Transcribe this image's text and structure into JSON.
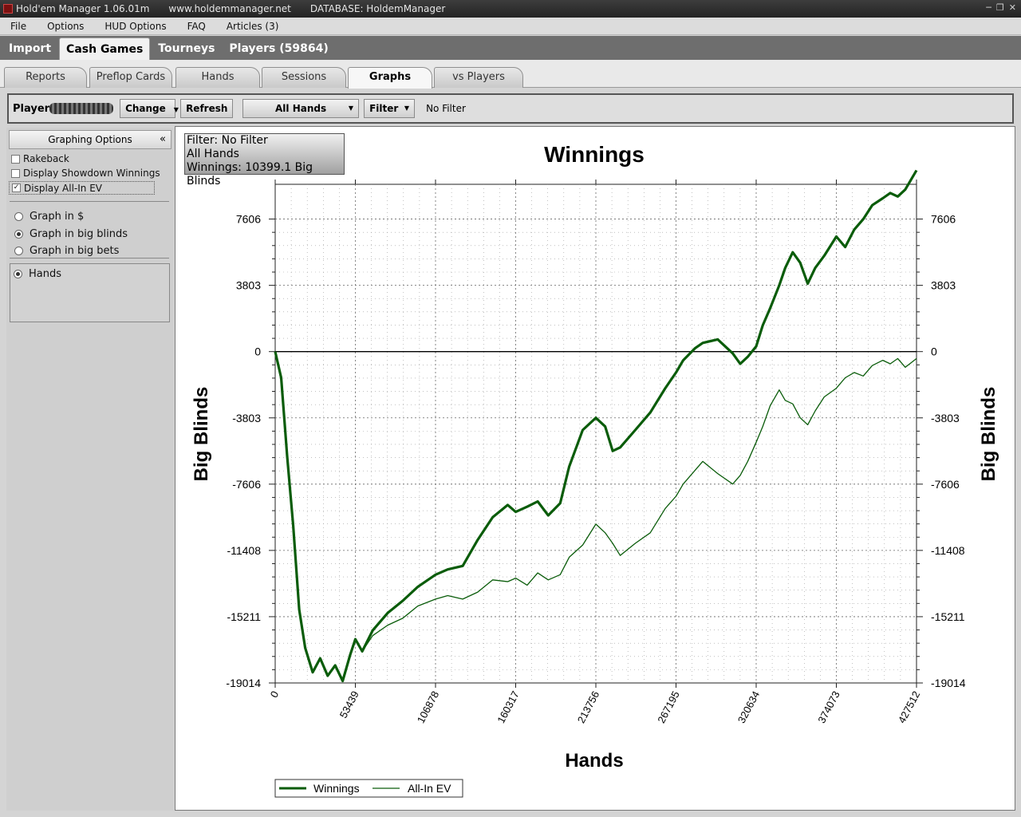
{
  "titlebar": {
    "app": "Hold'em Manager 1.06.01m",
    "site": "www.holdemmanager.net",
    "database": "DATABASE: HoldemManager"
  },
  "menu": [
    "File",
    "Options",
    "HUD Options",
    "FAQ",
    "Articles (3)"
  ],
  "main_tabs": [
    {
      "label": "Import",
      "active": false
    },
    {
      "label": "Cash Games",
      "active": true
    },
    {
      "label": "Tourneys",
      "active": false
    },
    {
      "label": "Players (59864)",
      "active": false
    }
  ],
  "sub_tabs": [
    {
      "label": "Reports",
      "active": false
    },
    {
      "label": "Preflop Cards",
      "active": false
    },
    {
      "label": "Hands",
      "active": false
    },
    {
      "label": "Sessions",
      "active": false
    },
    {
      "label": "Graphs",
      "active": true
    },
    {
      "label": "vs Players",
      "active": false
    }
  ],
  "player_bar": {
    "player_label": "Player",
    "change": "Change",
    "refresh": "Refresh",
    "hands_select": "All Hands",
    "filter": "Filter",
    "filter_status": "No Filter"
  },
  "sidebar": {
    "title": "Graphing Options",
    "collapse_glyph": "«",
    "checkboxes": [
      {
        "label": "Rakeback",
        "checked": false
      },
      {
        "label": "Display Showdown Winnings",
        "checked": false
      },
      {
        "label": "Display All-In EV",
        "checked": true
      }
    ],
    "units": [
      {
        "label": "Graph in $",
        "selected": false
      },
      {
        "label": "Graph in big blinds",
        "selected": true
      },
      {
        "label": "Graph in big bets",
        "selected": false
      }
    ],
    "x_axis_options": [
      {
        "label": "Hands",
        "selected": true
      }
    ]
  },
  "info_box": {
    "filter": "Filter: No Filter",
    "hands": "All Hands",
    "winnings": "Winnings: 10399.1 Big Blinds"
  },
  "colors": {
    "line": "#0a5c0a",
    "zero_line": "#000000",
    "grid": "#9a9a9a"
  },
  "chart_data": {
    "type": "line",
    "title": "Winnings",
    "xlabel": "Hands",
    "ylabel": "Big Blinds",
    "xlim": [
      0,
      427512
    ],
    "ylim": [
      -19014,
      9600
    ],
    "x_ticks": [
      0,
      53439,
      106878,
      160317,
      213756,
      267195,
      320634,
      374073,
      427512
    ],
    "y_ticks": [
      7606,
      3803,
      0,
      -3803,
      -7606,
      -11408,
      -15211,
      -19014
    ],
    "grid": true,
    "legend": "bottom-left",
    "series": [
      {
        "name": "Winnings",
        "x": [
          0,
          4000,
          8000,
          12000,
          16000,
          20000,
          25000,
          30000,
          35000,
          40000,
          45000,
          50000,
          53439,
          58000,
          65000,
          75000,
          85000,
          95000,
          106878,
          115000,
          125000,
          135000,
          145000,
          155000,
          160317,
          168000,
          175000,
          182000,
          190000,
          196000,
          205000,
          213756,
          220000,
          225000,
          230000,
          240000,
          250000,
          260000,
          267195,
          272000,
          280000,
          285000,
          295000,
          305000,
          310000,
          315000,
          320634,
          325000,
          330000,
          336000,
          340000,
          345000,
          350000,
          355000,
          360000,
          366000,
          374073,
          380000,
          386000,
          392000,
          398000,
          405000,
          410000,
          415000,
          420000,
          427512
        ],
        "values": [
          0,
          -1500,
          -6000,
          -10000,
          -14800,
          -17000,
          -18400,
          -17600,
          -18600,
          -18000,
          -18900,
          -17400,
          -16500,
          -17200,
          -16000,
          -15000,
          -14300,
          -13500,
          -12800,
          -12500,
          -12300,
          -10800,
          -9500,
          -8800,
          -9200,
          -8900,
          -8600,
          -9400,
          -8700,
          -6600,
          -4500,
          -3800,
          -4300,
          -5700,
          -5500,
          -4500,
          -3500,
          -2100,
          -1200,
          -500,
          200,
          500,
          700,
          -100,
          -700,
          -300,
          300,
          1500,
          2500,
          3800,
          4800,
          5700,
          5100,
          3900,
          4800,
          5500,
          6600,
          6000,
          7000,
          7600,
          8400,
          8800,
          9100,
          8900,
          9300,
          10399
        ]
      },
      {
        "name": "All-In EV",
        "x": [
          0,
          4000,
          8000,
          12000,
          16000,
          20000,
          25000,
          30000,
          35000,
          40000,
          45000,
          50000,
          53439,
          58000,
          65000,
          75000,
          85000,
          95000,
          106878,
          115000,
          125000,
          135000,
          145000,
          155000,
          160317,
          168000,
          175000,
          182000,
          190000,
          196000,
          205000,
          213756,
          220000,
          225000,
          230000,
          240000,
          250000,
          260000,
          267195,
          272000,
          280000,
          285000,
          295000,
          305000,
          310000,
          315000,
          320634,
          325000,
          330000,
          336000,
          340000,
          345000,
          350000,
          355000,
          360000,
          366000,
          374073,
          380000,
          386000,
          392000,
          398000,
          405000,
          410000,
          415000,
          420000,
          427512
        ],
        "values": [
          0,
          -1500,
          -6000,
          -10000,
          -14800,
          -17000,
          -18400,
          -17600,
          -18600,
          -18000,
          -18900,
          -17400,
          -16500,
          -17200,
          -16300,
          -15700,
          -15300,
          -14600,
          -14200,
          -14000,
          -14200,
          -13800,
          -13100,
          -13200,
          -13000,
          -13400,
          -12700,
          -13100,
          -12800,
          -11800,
          -11100,
          -9900,
          -10400,
          -11000,
          -11700,
          -11000,
          -10400,
          -9000,
          -8300,
          -7600,
          -6800,
          -6300,
          -7000,
          -7600,
          -7100,
          -6300,
          -5200,
          -4300,
          -3100,
          -2200,
          -2800,
          -3000,
          -3800,
          -4200,
          -3400,
          -2600,
          -2100,
          -1500,
          -1200,
          -1400,
          -800,
          -500,
          -700,
          -400,
          -900,
          -400
        ]
      }
    ]
  }
}
